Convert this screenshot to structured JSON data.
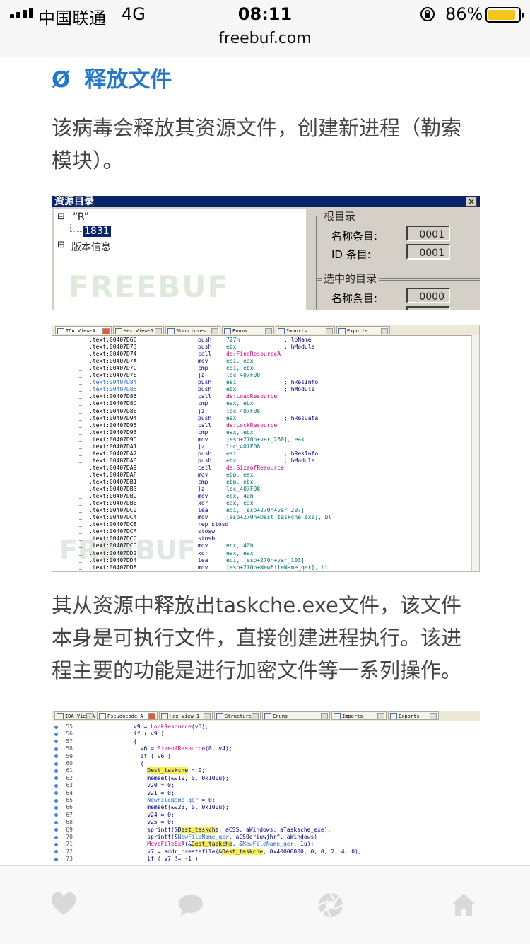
{
  "status_bar": {
    "carrier": "中国联通",
    "network": "4G",
    "time": "08:11",
    "battery": "86%"
  },
  "browser": {
    "url": "freebuf.com"
  },
  "article": {
    "heading_symbol": "Ø",
    "heading": "释放文件",
    "para1_line1": "该病毒会释放其资源文件，创建新进程（勒索",
    "para1_line2": "模块）。",
    "para2_line1": "其从资源中释放出taskche.exe文件，该文件",
    "para2_line2": "本身是可执行文件，直接创建进程执行。该进",
    "para2_line3": "程主要的功能是进行加密文件等一系列操作。"
  },
  "resource_dialog": {
    "title": "资源目录",
    "close": "×",
    "tree": {
      "root_toggle": "⊟",
      "root": "“R”",
      "child": "1831",
      "version_toggle": "⊞",
      "version": "版本信息"
    },
    "watermark": "FREEBUF",
    "root_group": {
      "legend": "根目录",
      "name_entries_label": "名称条目:",
      "name_entries_value": "0001",
      "id_entries_label": "ID 条目:",
      "id_entries_value": "0001"
    },
    "selected_group": {
      "legend": "选中的目录",
      "name_entries_label": "名称条目:",
      "name_entries_value": "0000"
    }
  },
  "ida_disasm": {
    "tabs": [
      "IDA View-A",
      "Hex View-1",
      "Structures",
      "Enums",
      "Imports",
      "Exports"
    ],
    "watermark": "FREEBUF",
    "lines": [
      {
        "addr": ".text:00407D6E",
        "mn": "push",
        "op": "727h",
        "cm": "; lpName"
      },
      {
        "addr": ".text:00407D73",
        "mn": "push",
        "op": "ebx",
        "cm": "; hModule"
      },
      {
        "addr": ".text:00407D74",
        "mn": "call",
        "op": "ds:FindResourceA",
        "cm": ""
      },
      {
        "addr": ".text:00407D7A",
        "mn": "mov",
        "op": "esi, eax",
        "cm": ""
      },
      {
        "addr": ".text:00407D7C",
        "mn": "cmp",
        "op": "esi, ebx",
        "cm": ""
      },
      {
        "addr": ".text:00407D7E",
        "mn": "jz",
        "op": "loc_407F08",
        "cm": ""
      },
      {
        "addr": ".text:00407D84",
        "mn": "push",
        "op": "esi",
        "cm": "; hResInfo"
      },
      {
        "addr": ".text:00407D85",
        "mn": "push",
        "op": "ebx",
        "cm": "; hModule"
      },
      {
        "addr": ".text:00407D86",
        "mn": "call",
        "op": "ds:LoadResource",
        "cm": ""
      },
      {
        "addr": ".text:00407D8C",
        "mn": "cmp",
        "op": "eax, ebx",
        "cm": ""
      },
      {
        "addr": ".text:00407D8E",
        "mn": "jz",
        "op": "loc_407F08",
        "cm": ""
      },
      {
        "addr": ".text:00407D94",
        "mn": "push",
        "op": "eax",
        "cm": "; hResData"
      },
      {
        "addr": ".text:00407D95",
        "mn": "call",
        "op": "ds:LockResource",
        "cm": ""
      },
      {
        "addr": ".text:00407D9B",
        "mn": "cmp",
        "op": "eax, ebx",
        "cm": ""
      },
      {
        "addr": ".text:00407D9D",
        "mn": "mov",
        "op": "[esp+270h+var_260], eax",
        "cm": ""
      },
      {
        "addr": ".text:00407DA1",
        "mn": "jz",
        "op": "loc_407F08",
        "cm": ""
      },
      {
        "addr": ".text:00407DA7",
        "mn": "push",
        "op": "esi",
        "cm": "; hResInfo"
      },
      {
        "addr": ".text:00407DA8",
        "mn": "push",
        "op": "ebx",
        "cm": "; hModule"
      },
      {
        "addr": ".text:00407DA9",
        "mn": "call",
        "op": "ds:SizeofResource",
        "cm": ""
      },
      {
        "addr": ".text:00407DAF",
        "mn": "mov",
        "op": "ebp, eax",
        "cm": ""
      },
      {
        "addr": ".text:00407DB1",
        "mn": "cmp",
        "op": "ebp, ebx",
        "cm": ""
      },
      {
        "addr": ".text:00407DB3",
        "mn": "jz",
        "op": "loc_407F08",
        "cm": ""
      },
      {
        "addr": ".text:00407DB9",
        "mn": "mov",
        "op": "ecx, 40h",
        "cm": ""
      },
      {
        "addr": ".text:00407DBE",
        "mn": "xor",
        "op": "eax, eax",
        "cm": ""
      },
      {
        "addr": ".text:00407DC0",
        "mn": "lea",
        "op": "edi, [esp+270h+var_207]",
        "cm": ""
      },
      {
        "addr": ".text:00407DC4",
        "mn": "mov",
        "op": "[esp+270h+Dest_taskche_exe], bl",
        "cm": ""
      },
      {
        "addr": ".text:00407DC8",
        "mn": "rep stosd",
        "op": "",
        "cm": ""
      },
      {
        "addr": ".text:00407DCA",
        "mn": "stosw",
        "op": "",
        "cm": ""
      },
      {
        "addr": ".text:00407DCC",
        "mn": "stosb",
        "op": "",
        "cm": ""
      },
      {
        "addr": ".text:00407DCD",
        "mn": "mov",
        "op": "ecx, 40h",
        "cm": ""
      },
      {
        "addr": ".text:00407DD2",
        "mn": "xor",
        "op": "eax, eax",
        "cm": ""
      },
      {
        "addr": ".text:00407DD4",
        "mn": "lea",
        "op": "edi, [esp+270h+var_103]",
        "cm": ""
      },
      {
        "addr": ".text:00407DD8",
        "mn": "mov",
        "op": "[esp+270h+NewFileName_qer], bl",
        "cm": ""
      }
    ]
  },
  "ida_pseudo": {
    "tabs": [
      "IDA View-A",
      "Pseudocode-A",
      "Hex View-1",
      "Structures",
      "Enums",
      "Imports",
      "Exports"
    ],
    "lines": [
      {
        "n": "55",
        "t": "v9 = LockResource(v5);"
      },
      {
        "n": "56",
        "t": "if ( v9 )"
      },
      {
        "n": "57",
        "t": "{"
      },
      {
        "n": "58",
        "t": "  v6 = SizeofResource(0, v4);"
      },
      {
        "n": "59",
        "t": "  if ( v6 )"
      },
      {
        "n": "60",
        "t": "  {"
      },
      {
        "n": "61",
        "t": "    Dest_taskche = 0;"
      },
      {
        "n": "62",
        "t": "    memset(&v19, 0, 0x100u);"
      },
      {
        "n": "63",
        "t": "    v20 = 0;"
      },
      {
        "n": "64",
        "t": "    v21 = 0;"
      },
      {
        "n": "65",
        "t": "    NewFileName_qer = 0;"
      },
      {
        "n": "66",
        "t": "    memset(&v23, 0, 0x100u);"
      },
      {
        "n": "67",
        "t": "    v24 = 0;"
      },
      {
        "n": "68",
        "t": "    v25 = 0;"
      },
      {
        "n": "69",
        "t": "    sprintf(&Dest_taskche, aCSS, aWindows, aTasksche_exe);"
      },
      {
        "n": "70",
        "t": "    sprintf(&NewFileName_qer, aCSQeriuwjhrf, aWindows);"
      },
      {
        "n": "71",
        "t": "    MoveFileExA(&Dest_taskche, &NewFileName_qer, 1u);"
      },
      {
        "n": "72",
        "t": "    v7 = addr_createfile(&Dest_taskche, 0x40000000, 0, 0, 2, 4, 0);"
      },
      {
        "n": "73",
        "t": "    if ( v7 != -1 )"
      }
    ]
  },
  "colors": {
    "heading": "#2878c8",
    "text": "#444444",
    "battery": "#f3c51d",
    "highlight": "#f8ef4a",
    "win_title": "#0a246a"
  },
  "toolbar_icons": [
    "heart-icon",
    "comment-icon",
    "aperture-icon",
    "home-icon"
  ]
}
